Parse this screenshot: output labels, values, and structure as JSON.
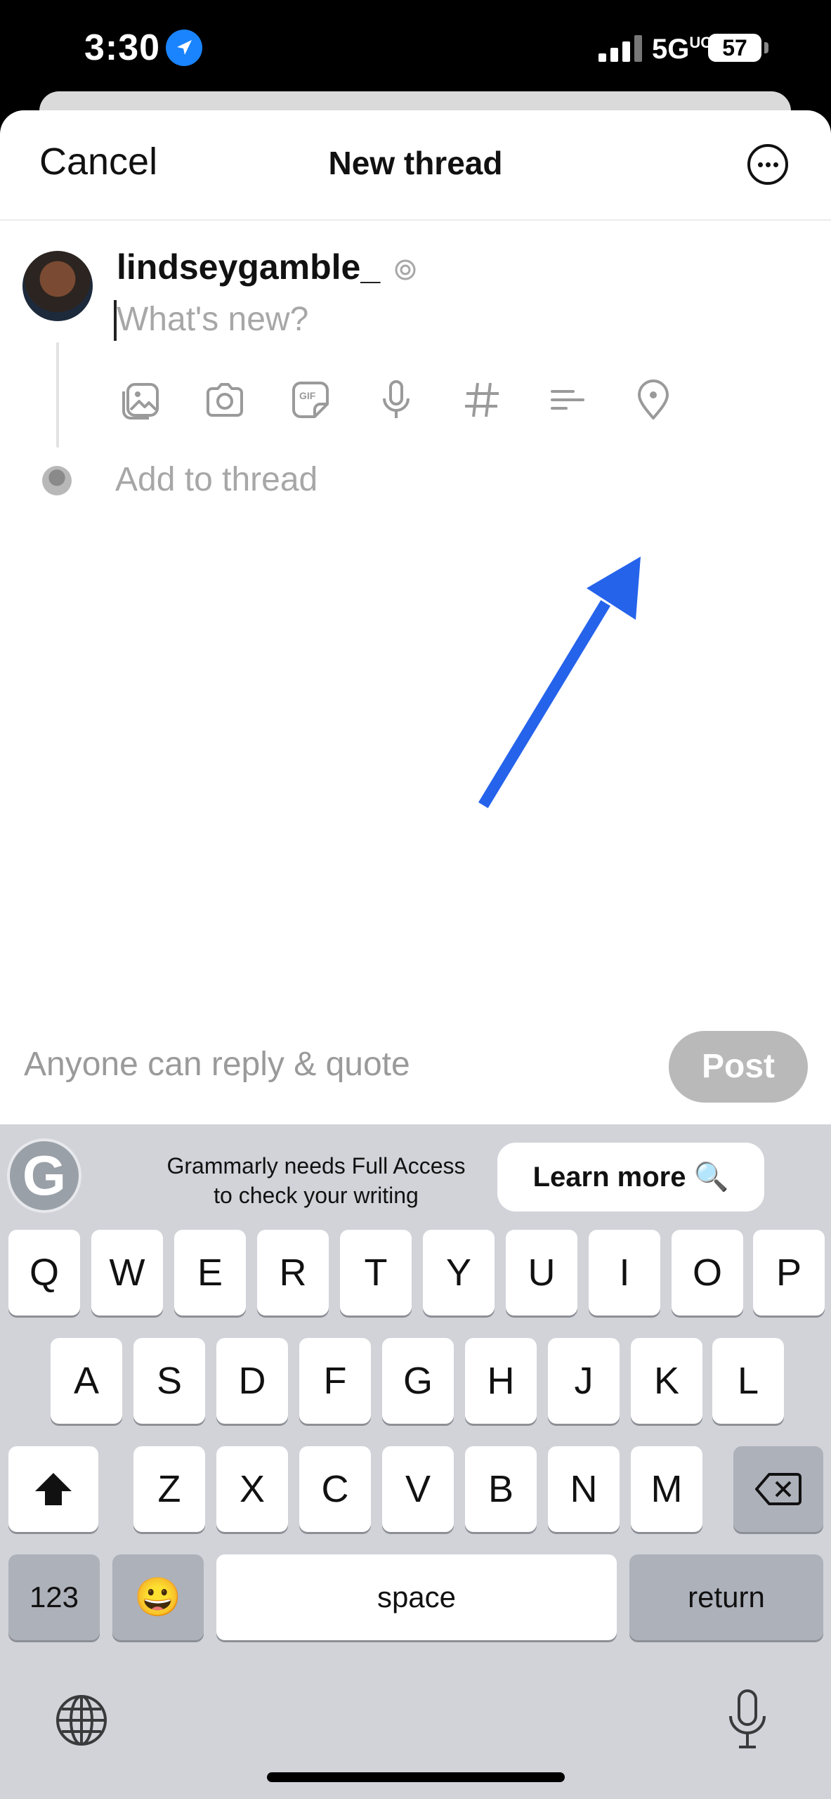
{
  "status_bar": {
    "time": "3:30",
    "network": "5G",
    "network_suffix": "UC",
    "battery": "57",
    "icons": [
      "location-arrow-icon",
      "cellular-signal-icon",
      "battery-icon"
    ]
  },
  "header": {
    "cancel_label": "Cancel",
    "title": "New thread",
    "more_icon": "more-options-icon"
  },
  "composer": {
    "username": "lindseygamble_",
    "username_icon": "threads-badge-icon",
    "placeholder": "What's new?",
    "value": "",
    "tools": [
      "gallery-icon",
      "camera-icon",
      "gif-icon",
      "microphone-icon",
      "hashtag-icon",
      "poll-icon",
      "location-pin-icon"
    ],
    "add_to_thread": "Add to thread"
  },
  "annotation": {
    "type": "arrow",
    "color": "#2563eb",
    "points_to": "location-pin-icon"
  },
  "footer": {
    "reply_setting": "Anyone can reply & quote",
    "post_label": "Post"
  },
  "keyboard": {
    "grammarly_message_line1": "Grammarly needs Full Access",
    "grammarly_message_line2": "to check your writing",
    "learn_more": "Learn more 🔍",
    "row1": [
      "Q",
      "W",
      "E",
      "R",
      "T",
      "Y",
      "U",
      "I",
      "O",
      "P"
    ],
    "row2": [
      "A",
      "S",
      "D",
      "F",
      "G",
      "H",
      "J",
      "K",
      "L"
    ],
    "row3": [
      "Z",
      "X",
      "C",
      "V",
      "B",
      "N",
      "M"
    ],
    "numbers_key": "123",
    "emoji_key": "😀",
    "space_key": "space",
    "return_key": "return",
    "shift_icon": "shift-icon",
    "delete_icon": "delete-icon",
    "globe_icon": "globe-icon",
    "dictation_icon": "microphone-icon"
  },
  "colors": {
    "accent_arrow": "#2563eb",
    "post_disabled": "#b9b9b9",
    "keyboard_bg": "#d1d3d9"
  }
}
